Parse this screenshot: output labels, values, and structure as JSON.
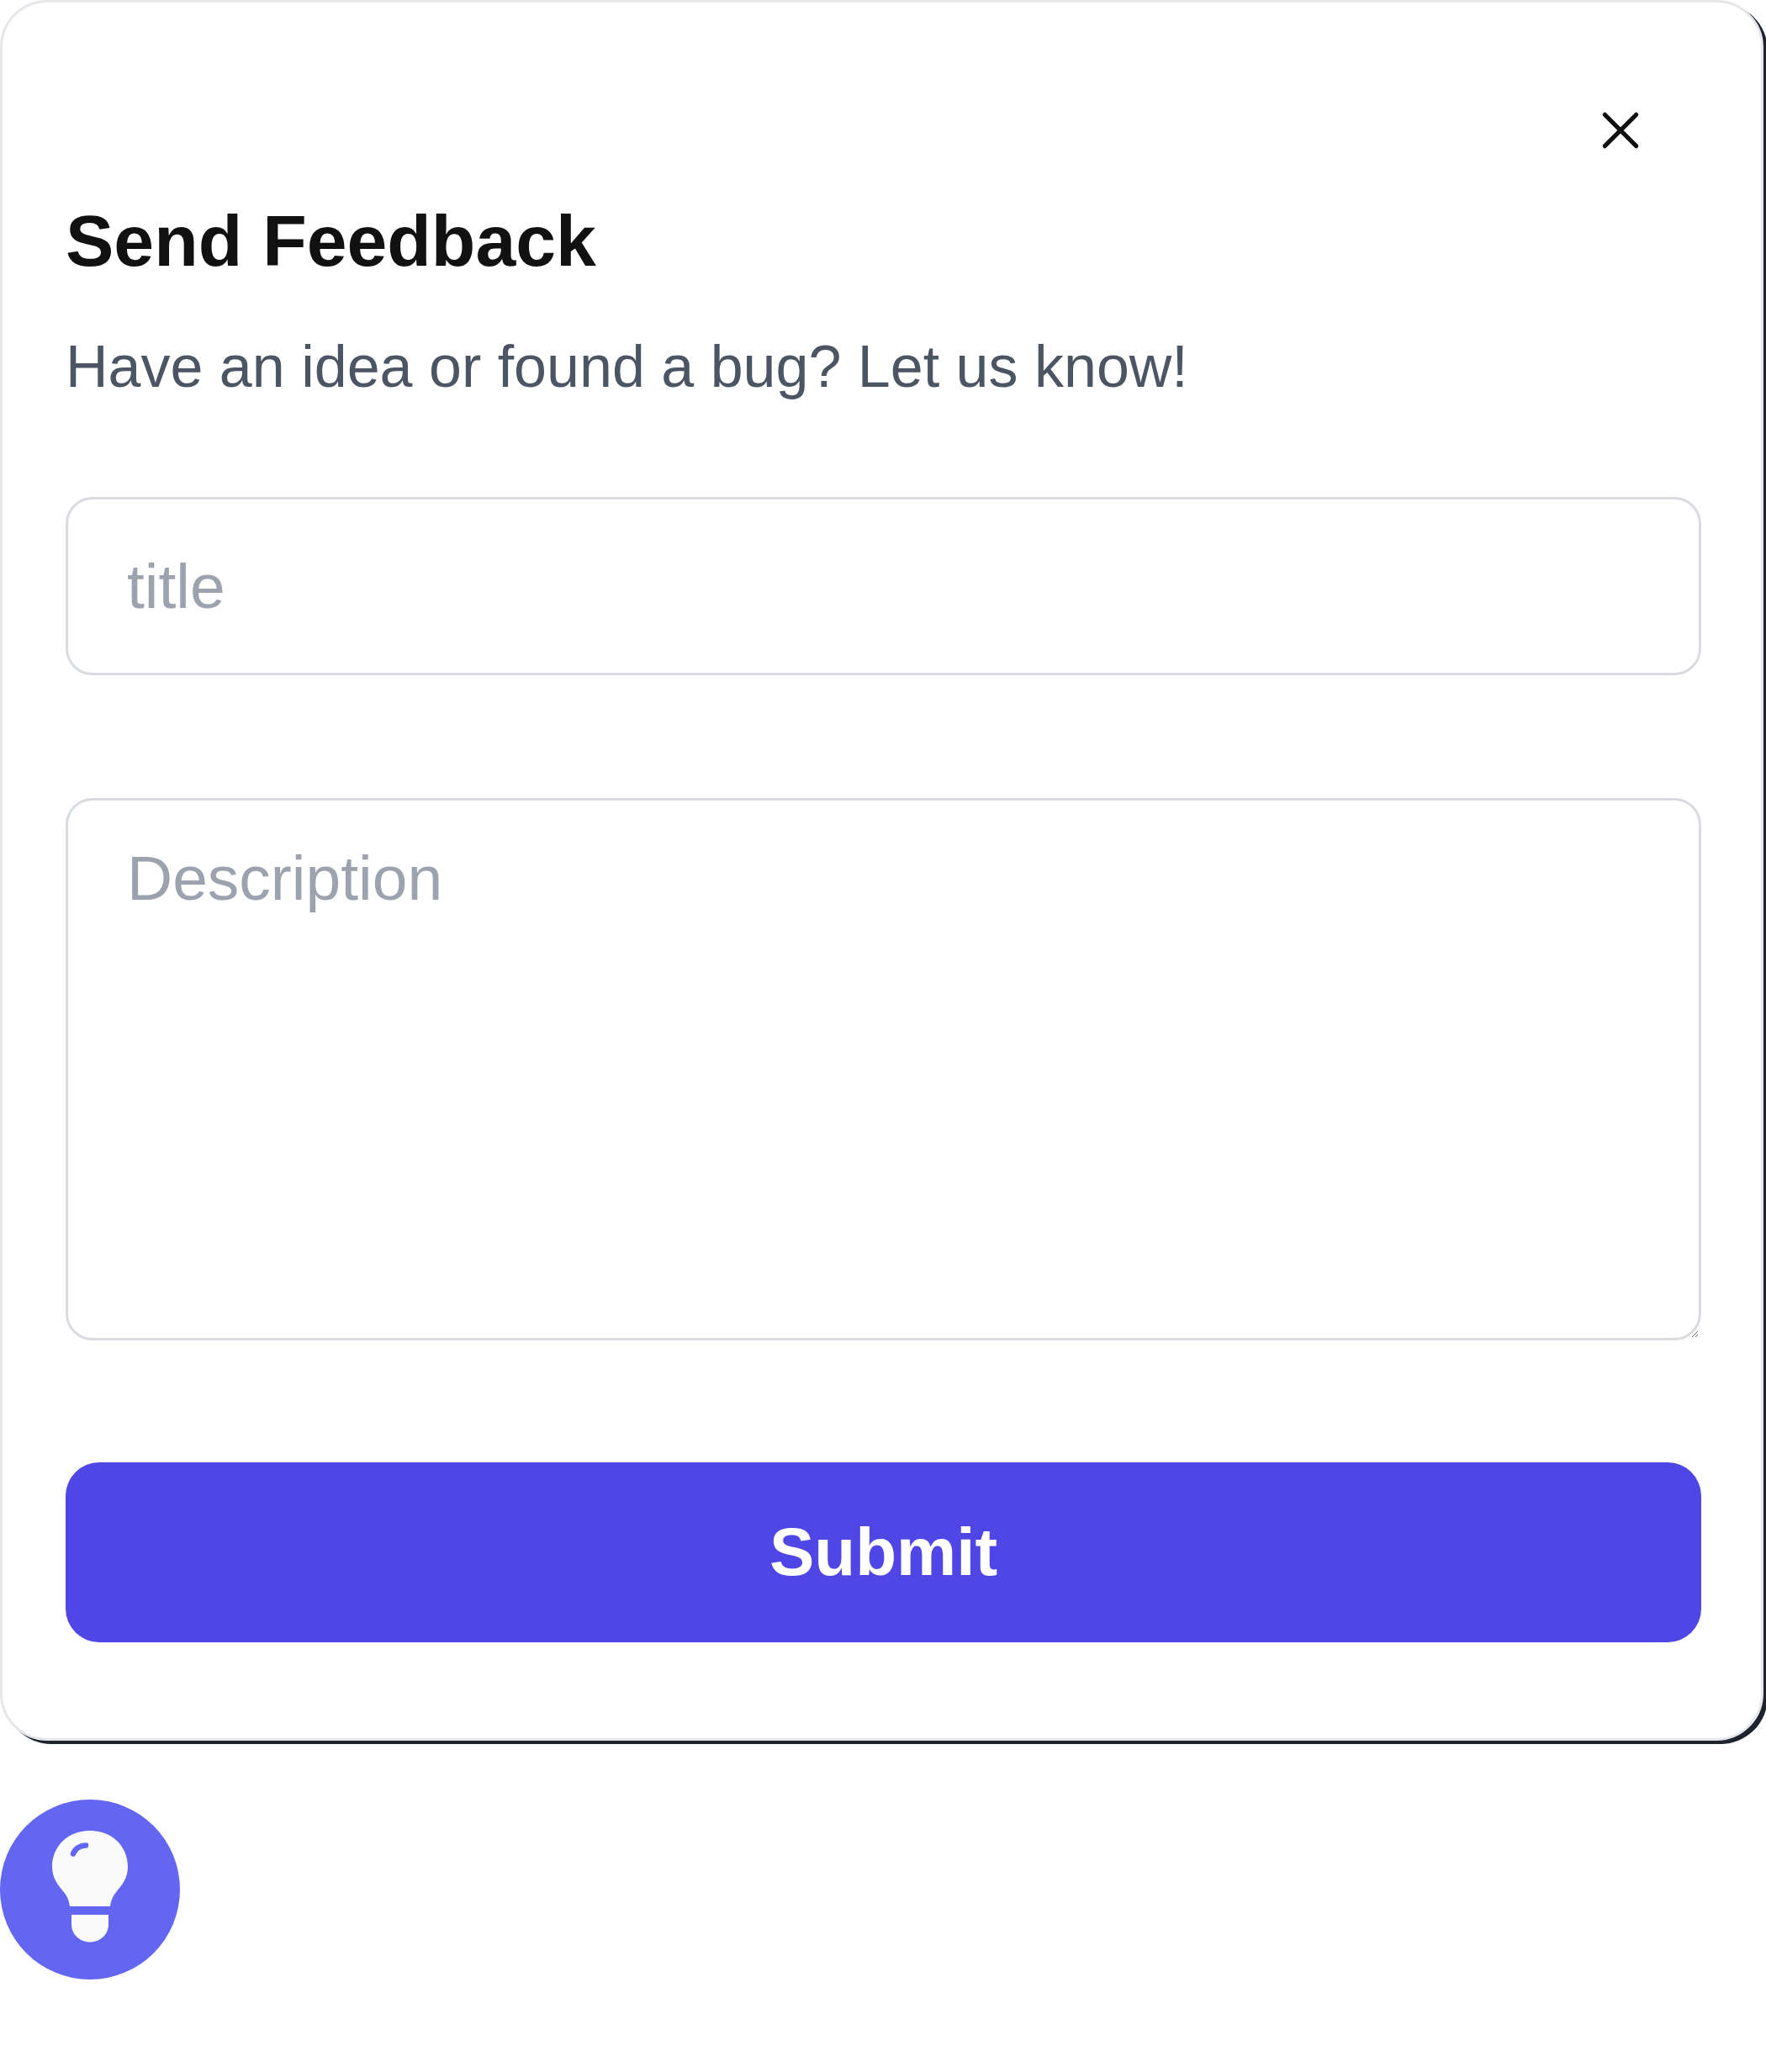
{
  "dialog": {
    "title": "Send Feedback",
    "subtitle": "Have an idea or found a bug? Let us know!",
    "fields": [
      {
        "kind": "input",
        "placeholder": "title"
      },
      {
        "kind": "textarea",
        "placeholder": "Description"
      }
    ],
    "submit": "Submit"
  }
}
